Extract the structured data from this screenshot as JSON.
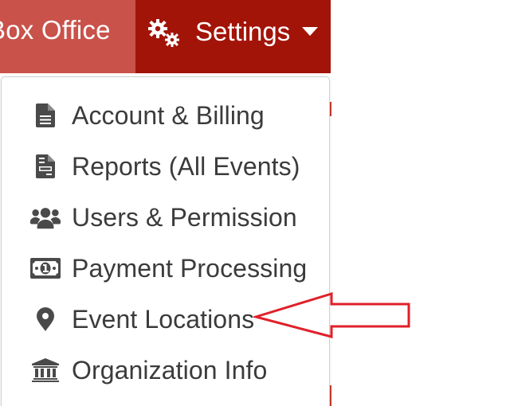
{
  "nav": {
    "box_office_label": "Box Office",
    "settings_label": "Settings",
    "settings_icon": "gears-icon",
    "settings_caret_icon": "caret-down-icon"
  },
  "colors": {
    "box_office_bg": "#c9524a",
    "settings_bg": "#a31408",
    "menu_text": "#3b3b3b",
    "icon_fill": "#4a4a4a",
    "annotation_arrow": "#e0202a"
  },
  "dropdown": {
    "items": [
      {
        "label": "Account & Billing",
        "icon": "file-icon"
      },
      {
        "label": "Reports (All Events)",
        "icon": "file-lines-icon"
      },
      {
        "label": "Users & Permission",
        "icon": "users-icon"
      },
      {
        "label": "Payment Processing",
        "icon": "money-bill-icon"
      },
      {
        "label": "Event Locations",
        "icon": "map-marker-icon"
      },
      {
        "label": "Organization Info",
        "icon": "bank-icon"
      }
    ]
  },
  "annotation": {
    "type": "arrow",
    "points_to": "Event Locations",
    "color": "#e0202a"
  }
}
